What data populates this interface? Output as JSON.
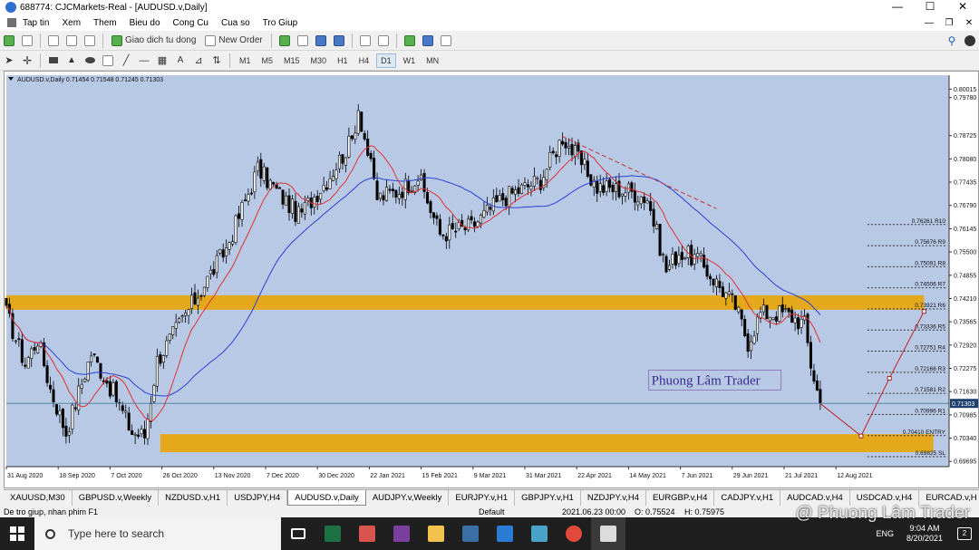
{
  "window": {
    "title": "688774: CJCMarkets-Real - [AUDUSD.v,Daily]",
    "min": "—",
    "max": "☐",
    "close": "✕"
  },
  "menu": {
    "items": [
      "Tap tin",
      "Xem",
      "Them",
      "Bieu do",
      "Cong Cu",
      "Cua so",
      "Tro Giup"
    ],
    "right_buttons": [
      "—",
      "❐",
      "✕"
    ]
  },
  "toolbar": {
    "auto_trading": "Giao dich tu dong",
    "new_order": "New Order",
    "timeframes": [
      "M1",
      "M5",
      "M15",
      "M30",
      "H1",
      "H4",
      "D1",
      "W1",
      "MN"
    ],
    "active_timeframe": "D1",
    "text_tool": "A"
  },
  "chart": {
    "header": "AUDUSD.v,Daily  0.71454 0.71548 0.71245 0.71303",
    "bg_color": "#b8c9e6",
    "zone_color": "#e3a81c",
    "current_price": "0.71303",
    "watermark_text": "Phuong Lâm Trader"
  },
  "chart_data": {
    "type": "candlestick",
    "symbol": "AUDUSD.v",
    "timeframe": "Daily",
    "ohlc_last": {
      "open": 0.71454,
      "high": 0.71548,
      "low": 0.71245,
      "close": 0.71303
    },
    "y_ticks": [
      "0.80015",
      "0.79780",
      "0.78725",
      "0.78080",
      "0.77435",
      "0.76790",
      "0.76145",
      "0.75500",
      "0.74855",
      "0.74210",
      "0.73565",
      "0.72920",
      "0.72275",
      "0.71630",
      "0.70985",
      "0.70340",
      "0.69695"
    ],
    "x_ticks": [
      "31 Aug 2020",
      "18 Sep 2020",
      "7 Oct 2020",
      "26 Oct 2020",
      "13 Nov 2020",
      "7 Dec 2020",
      "30 Dec 2020",
      "22 Jan 2021",
      "15 Feb 2021",
      "9 Mar 2021",
      "31 Mar 2021",
      "22 Apr 2021",
      "14 May 2021",
      "7 Jun 2021",
      "29 Jun 2021",
      "21 Jul 2021",
      "12 Aug 2021"
    ],
    "price_path": [
      {
        "t": 0,
        "p": 0.738
      },
      {
        "t": 6,
        "p": 0.724
      },
      {
        "t": 10,
        "p": 0.731
      },
      {
        "t": 14,
        "p": 0.717
      },
      {
        "t": 19,
        "p": 0.705
      },
      {
        "t": 27,
        "p": 0.727
      },
      {
        "t": 34,
        "p": 0.716
      },
      {
        "t": 40,
        "p": 0.705
      },
      {
        "t": 44,
        "p": 0.704
      },
      {
        "t": 48,
        "p": 0.725
      },
      {
        "t": 58,
        "p": 0.739
      },
      {
        "t": 70,
        "p": 0.756
      },
      {
        "t": 80,
        "p": 0.778
      },
      {
        "t": 93,
        "p": 0.765
      },
      {
        "t": 102,
        "p": 0.775
      },
      {
        "t": 110,
        "p": 0.786
      },
      {
        "t": 112,
        "p": 0.795
      },
      {
        "t": 118,
        "p": 0.77
      },
      {
        "t": 125,
        "p": 0.772
      },
      {
        "t": 131,
        "p": 0.776
      },
      {
        "t": 138,
        "p": 0.76
      },
      {
        "t": 148,
        "p": 0.762
      },
      {
        "t": 158,
        "p": 0.77
      },
      {
        "t": 170,
        "p": 0.775
      },
      {
        "t": 177,
        "p": 0.787
      },
      {
        "t": 188,
        "p": 0.773
      },
      {
        "t": 198,
        "p": 0.772
      },
      {
        "t": 204,
        "p": 0.77
      },
      {
        "t": 210,
        "p": 0.75
      },
      {
        "t": 214,
        "p": 0.755
      },
      {
        "t": 220,
        "p": 0.753
      },
      {
        "t": 232,
        "p": 0.74
      },
      {
        "t": 236,
        "p": 0.73
      },
      {
        "t": 240,
        "p": 0.738
      },
      {
        "t": 248,
        "p": 0.738
      },
      {
        "t": 254,
        "p": 0.735
      },
      {
        "t": 256,
        "p": 0.724
      },
      {
        "t": 259,
        "p": 0.713
      }
    ],
    "resistance_zone": {
      "high": 0.743,
      "low": 0.739,
      "label": ""
    },
    "support_zone": {
      "high": 0.7045,
      "low": 0.6995,
      "label": ""
    },
    "horizontal_levels": [
      {
        "label": "0.76261 R10",
        "price": 0.76261
      },
      {
        "label": "0.75676 R9",
        "price": 0.75676
      },
      {
        "label": "0.75091 R8",
        "price": 0.75091
      },
      {
        "label": "0.74506 R7",
        "price": 0.74506
      },
      {
        "label": "0.73921 R6",
        "price": 0.73921
      },
      {
        "label": "0.73336 R5",
        "price": 0.73336
      },
      {
        "label": "0.72751 R4",
        "price": 0.72751
      },
      {
        "label": "0.72166 R3",
        "price": 0.72166
      },
      {
        "label": "0.71581 R2",
        "price": 0.71581
      },
      {
        "label": "0.70996 R1",
        "price": 0.70996
      },
      {
        "label": "0.70410 ENTRY",
        "price": 0.7041
      },
      {
        "label": "0.69825 SL",
        "price": 0.69825
      }
    ],
    "projection_path": [
      {
        "t": 259,
        "p": 0.713
      },
      {
        "t": 272,
        "p": 0.704
      },
      {
        "t": 281,
        "p": 0.72
      },
      {
        "t": 292,
        "p": 0.7385
      }
    ]
  },
  "tabs": {
    "items": [
      "XAUUSD,M30",
      "GBPUSD.v,Weekly",
      "NZDUSD.v,H1",
      "USDJPY,H4",
      "AUDUSD.v,Daily",
      "AUDJPY.v,Weekly",
      "EURJPY.v,H1",
      "GBPJPY.v,H1",
      "NZDJPY.v,H4",
      "EURGBP.v,H4",
      "CADJPY.v,H1",
      "AUDCAD.v,H4",
      "USDCAD.v,H4",
      "EURCAD.v,H"
    ],
    "active_index": 4
  },
  "status": {
    "help": "De tro giup, nhan phim F1",
    "profile": "Default",
    "time": "2021.06.23 00:00",
    "open": "O: 0.75524",
    "high": "H: 0.75975"
  },
  "taskbar": {
    "search_placeholder": "Type here to search",
    "lang": "ENG",
    "time": "9:04 AM",
    "date": "8/20/2021",
    "notif_count": "2"
  },
  "watermark": "@ Phuong Lâm Trader"
}
